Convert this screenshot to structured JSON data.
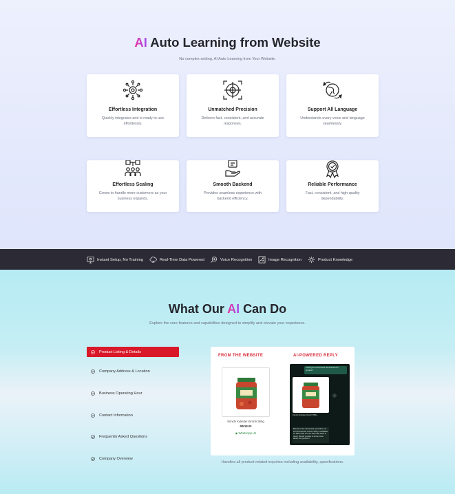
{
  "section1": {
    "title_ai": "AI",
    "title_rest": " Auto Learning from Website",
    "subtitle": "No complex setting. AI Auto Learning from Your Website."
  },
  "cards": [
    {
      "title": "Effortless Integration",
      "desc": "Quickly integrates and is ready to use effortlessly.",
      "icon": "network-gear-icon"
    },
    {
      "title": "Unmatched Precision",
      "desc": "Delivers fast, consistent, and accurate responses.",
      "icon": "target-crosshair-icon"
    },
    {
      "title": "Support All Language",
      "desc": "Understands every voice and language seamlessly.",
      "icon": "globe-chat-icon"
    },
    {
      "title": "Effortless Scaling",
      "desc": "Grows to handle more customers as your business expands.",
      "icon": "team-scaling-icon"
    },
    {
      "title": "Smooth Backend",
      "desc": "Provides seamless experience with backend efficiency.",
      "icon": "backend-hand-icon"
    },
    {
      "title": "Reliable Performance",
      "desc": "Fast, consistent, and high-quality dependability.",
      "icon": "badge-check-icon"
    }
  ],
  "feature_bar": [
    {
      "label": "Instant Setup, No Training",
      "icon": "setup-screen-icon"
    },
    {
      "label": "Real-Time Data Powered",
      "icon": "cloud-data-icon"
    },
    {
      "label": "Voice Recognition",
      "icon": "voice-search-icon"
    },
    {
      "label": "Image Recognition",
      "icon": "image-scan-icon"
    },
    {
      "label": "Product Knowledge",
      "icon": "product-gear-icon"
    }
  ],
  "section2": {
    "title_pre": "What Our ",
    "title_ai": "AI",
    "title_post": " Can Do",
    "subtitle": "Explore the core features and capabilities designed to simplify and elevate your experience."
  },
  "tabs": [
    {
      "label": "Product Listing & Details",
      "active": true
    },
    {
      "label": "Company Address & Location",
      "active": false
    },
    {
      "label": "Business Operating Hour",
      "active": false
    },
    {
      "label": "Contact Information",
      "active": false
    },
    {
      "label": "Frequently Asked Questions",
      "active": false
    },
    {
      "label": "Company Overview",
      "active": false
    }
  ],
  "preview": {
    "left_heading": "FROM THE WEBSITE",
    "right_heading": "AI-POWERED REPLY",
    "product_name": "Kimchi Kulinder Kimchi 550g",
    "price": "RM18.00",
    "whatsapp": "WhatsApp Us",
    "chat_question": "Could you recommend the best kimchi product?",
    "chat_reply_1": "Kimchi Kulinder Kimchi 550g",
    "chat_reply_2": "Based on the information provided, our Kimchi Kulinder Kimchi 550g is available for RM 18.00 and we have RM stock in stock. Would you like to know more about this product?",
    "caption": "Handles all product-related inquiries including availability, specifications."
  },
  "colors": {
    "accent_red": "#d9192a",
    "ai_gradient_start": "#e8339a",
    "ai_gradient_end": "#a34ff0",
    "bar_bg": "#2c2b35"
  }
}
